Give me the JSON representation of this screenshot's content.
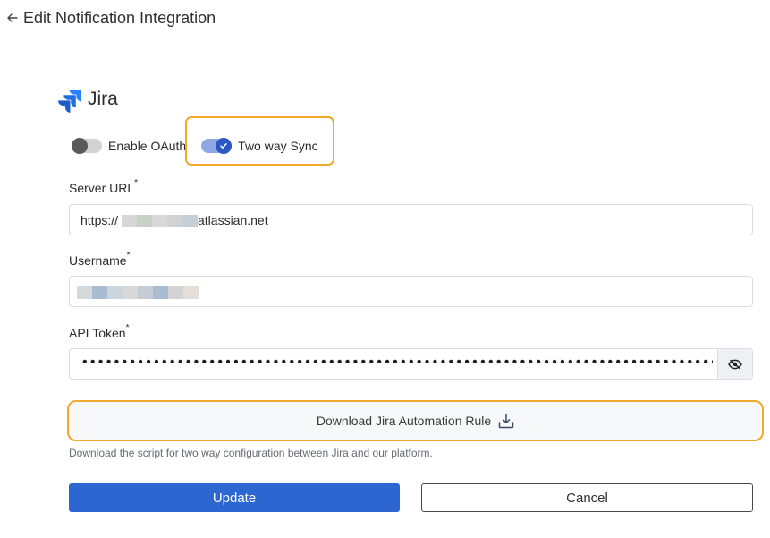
{
  "header": {
    "title": "Edit Notification Integration"
  },
  "integration": {
    "name": "Jira"
  },
  "toggles": {
    "enable_oauth": {
      "label": "Enable OAuth",
      "enabled": false
    },
    "two_way_sync": {
      "label": "Two way Sync",
      "enabled": true
    }
  },
  "form": {
    "server_url": {
      "label": "Server URL",
      "required_mark": "*",
      "value_prefix": "https://",
      "value_suffix": "atlassian.net"
    },
    "username": {
      "label": "Username",
      "required_mark": "*"
    },
    "api_token": {
      "label": "API Token",
      "required_mark": "*",
      "masked_value": "•••••••••••••••••••••••••••••••••••••••••••••••••••••••••••••••••••••••••••••••••••"
    }
  },
  "download": {
    "label": "Download Jira Automation Rule",
    "helper": "Download the script for two way configuration between Jira and our platform."
  },
  "actions": {
    "update_label": "Update",
    "cancel_label": "Cancel"
  },
  "colors": {
    "accent": "#2c67d1",
    "highlight": "#f0a92a",
    "jira_blue": "#2684ff"
  }
}
